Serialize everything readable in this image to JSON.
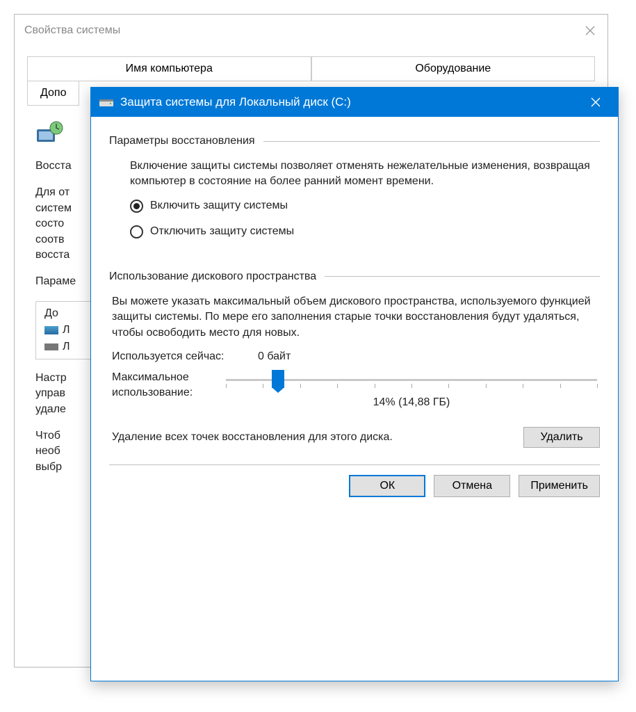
{
  "bgWindow": {
    "title": "Свойства системы",
    "tabs": {
      "computerName": "Имя компьютера",
      "hardware": "Оборудование",
      "advanced": "Допо"
    },
    "restoreHeading": "Восста",
    "para1": "Для от\nсистем\nсосто\nсоотв\nвосста",
    "paramsLabel": "Параме",
    "driveListHeader": "До",
    "drive1": "Л",
    "drive2": "Л",
    "para2": "Настр\nуправ\nудале",
    "para3": "Чтоб\nнеоб\nвыбр"
  },
  "dialog": {
    "title": "Защита системы для Локальный диск (C:)",
    "section1": {
      "title": "Параметры восстановления",
      "desc": "Включение защиты системы позволяет отменять нежелательные изменения, возвращая компьютер в состояние на более ранний момент времени.",
      "opt_enable": "Включить защиту системы",
      "opt_disable": "Отключить защиту системы"
    },
    "section2": {
      "title": "Использование дискового пространства",
      "desc": "Вы можете указать максимальный объем дискового пространства, используемого функцией защиты системы. По мере его заполнения старые точки восстановления будут удаляться, чтобы освободить место для новых.",
      "current_label": "Используется сейчас:",
      "current_value": "0 байт",
      "max_label": "Максимальное использование:",
      "slider_percent": 14,
      "slider_text": "14% (14,88 ГБ)",
      "delete_desc": "Удаление всех точек восстановления для этого диска.",
      "delete_btn": "Удалить"
    },
    "buttons": {
      "ok": "ОК",
      "cancel": "Отмена",
      "apply": "Применить"
    }
  }
}
